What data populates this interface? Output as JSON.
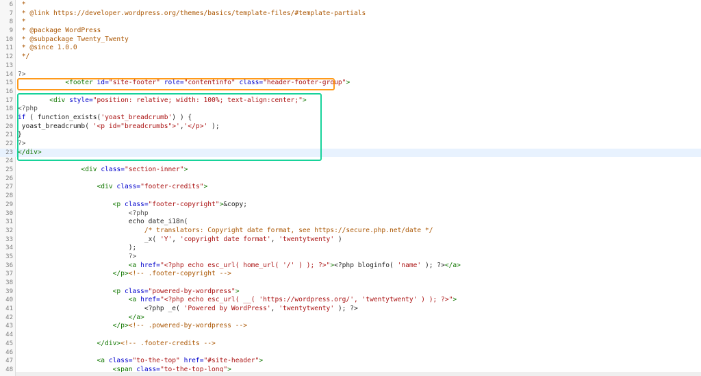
{
  "editor": {
    "lines": [
      {
        "n": "6",
        "segs": [
          [
            "c-comment",
            " *"
          ]
        ]
      },
      {
        "n": "7",
        "segs": [
          [
            "c-comment",
            " * @link https://developer.wordpress.org/themes/basics/template-files/#template-partials"
          ]
        ]
      },
      {
        "n": "8",
        "segs": [
          [
            "c-comment",
            " *"
          ]
        ]
      },
      {
        "n": "9",
        "segs": [
          [
            "c-comment",
            " * @package WordPress"
          ]
        ]
      },
      {
        "n": "10",
        "segs": [
          [
            "c-comment",
            " * @subpackage Twenty_Twenty"
          ]
        ]
      },
      {
        "n": "11",
        "segs": [
          [
            "c-comment",
            " * @since 1.0.0"
          ]
        ]
      },
      {
        "n": "12",
        "segs": [
          [
            "c-comment",
            " */"
          ]
        ]
      },
      {
        "n": "13",
        "segs": []
      },
      {
        "n": "14",
        "segs": [
          [
            "c-php",
            "?>"
          ]
        ]
      },
      {
        "n": "15",
        "segs": [
          [
            "",
            "            "
          ],
          [
            "c-tag",
            "<footer "
          ],
          [
            "c-attr",
            "id="
          ],
          [
            "c-str",
            "\"site-footer\" "
          ],
          [
            "c-attr",
            "role="
          ],
          [
            "c-str",
            "\"contentinfo\" "
          ],
          [
            "c-attr",
            "class="
          ],
          [
            "c-str",
            "\"header-footer-group\""
          ],
          [
            "c-tag",
            ">"
          ]
        ]
      },
      {
        "n": "16",
        "segs": []
      },
      {
        "n": "17",
        "segs": [
          [
            "",
            "        "
          ],
          [
            "c-tag",
            "<div "
          ],
          [
            "c-attr",
            "style="
          ],
          [
            "c-str",
            "\"position: relative; width: 100%; text-align:center;\""
          ],
          [
            "c-tag",
            ">"
          ]
        ]
      },
      {
        "n": "18",
        "segs": [
          [
            "c-php",
            "<?php"
          ]
        ]
      },
      {
        "n": "19",
        "segs": [
          [
            "c-attr",
            "if"
          ],
          [
            "",
            " ( function_exists("
          ],
          [
            "c-str",
            "'yoast_breadcrumb'"
          ],
          [
            "",
            ") ) {"
          ]
        ]
      },
      {
        "n": "20",
        "segs": [
          [
            "",
            " yoast_breadcrumb( "
          ],
          [
            "c-str",
            "'<p id=\"breadcrumbs\">'"
          ],
          [
            "",
            ","
          ],
          [
            "c-str",
            "'</p>'"
          ],
          [
            "",
            " );"
          ]
        ]
      },
      {
        "n": "21",
        "segs": [
          [
            "",
            "}"
          ]
        ]
      },
      {
        "n": "22",
        "segs": [
          [
            "c-php",
            "?>"
          ]
        ]
      },
      {
        "n": "23",
        "segs": [
          [
            "c-tag",
            "</div>"
          ]
        ],
        "highlight": true
      },
      {
        "n": "24",
        "segs": []
      },
      {
        "n": "25",
        "segs": [
          [
            "",
            "                "
          ],
          [
            "c-tag",
            "<div "
          ],
          [
            "c-attr",
            "class="
          ],
          [
            "c-str",
            "\"section-inner\""
          ],
          [
            "c-tag",
            ">"
          ]
        ]
      },
      {
        "n": "26",
        "segs": []
      },
      {
        "n": "27",
        "segs": [
          [
            "",
            "                    "
          ],
          [
            "c-tag",
            "<div "
          ],
          [
            "c-attr",
            "class="
          ],
          [
            "c-str",
            "\"footer-credits\""
          ],
          [
            "c-tag",
            ">"
          ]
        ]
      },
      {
        "n": "28",
        "segs": []
      },
      {
        "n": "29",
        "segs": [
          [
            "",
            "                        "
          ],
          [
            "c-tag",
            "<p "
          ],
          [
            "c-attr",
            "class="
          ],
          [
            "c-str",
            "\"footer-copyright\""
          ],
          [
            "c-tag",
            ">"
          ],
          [
            "",
            "&copy;"
          ]
        ]
      },
      {
        "n": "30",
        "segs": [
          [
            "",
            "                            "
          ],
          [
            "c-php",
            "<?php"
          ]
        ]
      },
      {
        "n": "31",
        "segs": [
          [
            "",
            "                            echo date_i18n("
          ]
        ]
      },
      {
        "n": "32",
        "segs": [
          [
            "",
            "                                "
          ],
          [
            "c-comment",
            "/* translators: Copyright date format, see https://secure.php.net/date */"
          ]
        ]
      },
      {
        "n": "33",
        "segs": [
          [
            "",
            "                                _x( "
          ],
          [
            "c-str",
            "'Y'"
          ],
          [
            "",
            ", "
          ],
          [
            "c-str",
            "'copyright date format'"
          ],
          [
            "",
            ", "
          ],
          [
            "c-str",
            "'twentytwenty'"
          ],
          [
            "",
            " )"
          ]
        ]
      },
      {
        "n": "34",
        "segs": [
          [
            "",
            "                            );"
          ]
        ]
      },
      {
        "n": "35",
        "segs": [
          [
            "",
            "                            "
          ],
          [
            "c-php",
            "?>"
          ]
        ]
      },
      {
        "n": "36",
        "segs": [
          [
            "",
            "                            "
          ],
          [
            "c-tag",
            "<a "
          ],
          [
            "c-attr",
            "href="
          ],
          [
            "c-str",
            "\"<?php echo esc_url( home_url( '/' ) ); ?>\""
          ],
          [
            "c-tag",
            ">"
          ],
          [
            "",
            "<?php bloginfo( "
          ],
          [
            "c-str",
            "'name'"
          ],
          [
            "",
            " ); ?>"
          ],
          [
            "c-tag",
            "</a>"
          ]
        ]
      },
      {
        "n": "37",
        "segs": [
          [
            "",
            "                        "
          ],
          [
            "c-tag",
            "</p>"
          ],
          [
            "c-comment",
            "<!-- .footer-copyright -->"
          ]
        ]
      },
      {
        "n": "38",
        "segs": []
      },
      {
        "n": "39",
        "segs": [
          [
            "",
            "                        "
          ],
          [
            "c-tag",
            "<p "
          ],
          [
            "c-attr",
            "class="
          ],
          [
            "c-str",
            "\"powered-by-wordpress\""
          ],
          [
            "c-tag",
            ">"
          ]
        ]
      },
      {
        "n": "40",
        "segs": [
          [
            "",
            "                            "
          ],
          [
            "c-tag",
            "<a "
          ],
          [
            "c-attr",
            "href="
          ],
          [
            "c-str",
            "\"<?php echo esc_url( __( 'https://wordpress.org/', 'twentytwenty' ) ); ?>\""
          ],
          [
            "c-tag",
            ">"
          ]
        ]
      },
      {
        "n": "41",
        "segs": [
          [
            "",
            "                                <?php _e( "
          ],
          [
            "c-str",
            "'Powered by WordPress'"
          ],
          [
            "",
            ", "
          ],
          [
            "c-str",
            "'twentytwenty'"
          ],
          [
            "",
            " ); ?>"
          ]
        ]
      },
      {
        "n": "42",
        "segs": [
          [
            "",
            "                            "
          ],
          [
            "c-tag",
            "</a>"
          ]
        ]
      },
      {
        "n": "43",
        "segs": [
          [
            "",
            "                        "
          ],
          [
            "c-tag",
            "</p>"
          ],
          [
            "c-comment",
            "<!-- .powered-by-wordpress -->"
          ]
        ]
      },
      {
        "n": "44",
        "segs": []
      },
      {
        "n": "45",
        "segs": [
          [
            "",
            "                    "
          ],
          [
            "c-tag",
            "</div>"
          ],
          [
            "c-comment",
            "<!-- .footer-credits -->"
          ]
        ]
      },
      {
        "n": "46",
        "segs": []
      },
      {
        "n": "47",
        "segs": [
          [
            "",
            "                    "
          ],
          [
            "c-tag",
            "<a "
          ],
          [
            "c-attr",
            "class="
          ],
          [
            "c-str",
            "\"to-the-top\" "
          ],
          [
            "c-attr",
            "href="
          ],
          [
            "c-str",
            "\"#site-header\""
          ],
          [
            "c-tag",
            ">"
          ]
        ]
      },
      {
        "n": "48",
        "segs": [
          [
            "",
            "                        "
          ],
          [
            "c-tag",
            "<span "
          ],
          [
            "c-attr",
            "class="
          ],
          [
            "c-str",
            "\"to-the-top-long\""
          ],
          [
            "c-tag",
            ">"
          ]
        ]
      }
    ]
  },
  "colors": {
    "orange_box": "#ff9a1a",
    "green_box": "#17d39a",
    "highlight_line": "#e8f2fe"
  }
}
